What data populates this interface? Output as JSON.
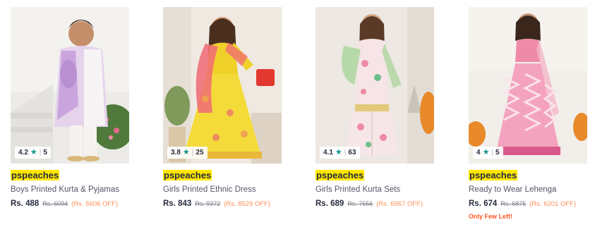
{
  "products": [
    {
      "rating": "4.2",
      "rating_count": "5",
      "brand": "pspeaches",
      "name": "Boys Printed Kurta & Pyjamas",
      "price": "Rs. 488",
      "mrp": "Rs. 6094",
      "discount": "(Rs. 5606 OFF)",
      "stock_note": ""
    },
    {
      "rating": "3.8",
      "rating_count": "25",
      "brand": "pspeaches",
      "name": "Girls Printed Ethnic Dress",
      "price": "Rs. 843",
      "mrp": "Rs. 9372",
      "discount": "(Rs. 8529 OFF)",
      "stock_note": ""
    },
    {
      "rating": "4.1",
      "rating_count": "63",
      "brand": "pspeaches",
      "name": "Girls Printed Kurta Sets",
      "price": "Rs. 689",
      "mrp": "Rs. 7656",
      "discount": "(Rs. 6967 OFF)",
      "stock_note": ""
    },
    {
      "rating": "4",
      "rating_count": "5",
      "brand": "pspeaches",
      "name": "Ready to Wear Lehenga",
      "price": "Rs. 674",
      "mrp": "Rs. 6875",
      "discount": "(Rs. 6201 OFF)",
      "stock_note": "Only Few Left!"
    }
  ],
  "icons": {
    "rating": "star-icon"
  },
  "colors": {
    "brand_highlight": "#ffe600",
    "star": "#14958f",
    "discount": "#ff905a",
    "stock_note": "#ff5722"
  }
}
